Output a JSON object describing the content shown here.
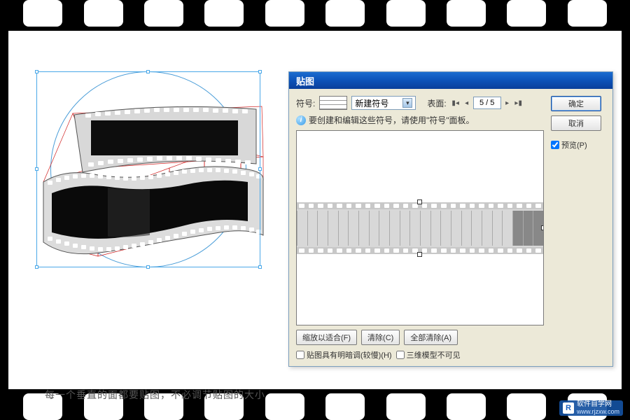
{
  "dialog": {
    "title": "贴图",
    "symbol_label": "符号:",
    "symbol_name": "新建符号",
    "surface_label": "表面:",
    "surface_value": "5 / 5",
    "hint": "要创建和编辑这些符号，请使用\"符号\"面板。",
    "ok": "确定",
    "cancel": "取消",
    "preview_label": "预览(P)",
    "scale_fit": "缩放以适合(F)",
    "clear": "清除(C)",
    "clear_all": "全部清除(A)",
    "shade_artwork": "贴图具有明暗调(较慢)(H)",
    "invisible_geometry": "三维模型不可见"
  },
  "caption": "每一个垂直的面都要贴图，不必调节贴图的大小",
  "watermark": {
    "brand": "软件自学网",
    "url": "www.rjzxw.com"
  }
}
